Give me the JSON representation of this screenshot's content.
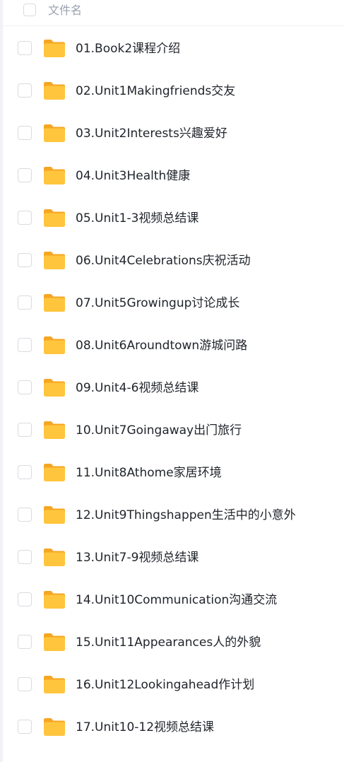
{
  "header": {
    "column_label": "文件名"
  },
  "folders": [
    {
      "name": "01.Book2课程介绍",
      "icon": "folder-icon"
    },
    {
      "name": "02.Unit1Makingfriends交友",
      "icon": "folder-icon"
    },
    {
      "name": "03.Unit2Interests兴趣爱好",
      "icon": "folder-icon"
    },
    {
      "name": "04.Unit3Health健康",
      "icon": "folder-icon"
    },
    {
      "name": "05.Unit1-3视频总结课",
      "icon": "folder-icon"
    },
    {
      "name": "06.Unit4Celebrations庆祝活动",
      "icon": "folder-icon"
    },
    {
      "name": "07.Unit5Growingup讨论成长",
      "icon": "folder-icon"
    },
    {
      "name": "08.Unit6Aroundtown游城问路",
      "icon": "folder-icon"
    },
    {
      "name": "09.Unit4-6视频总结课",
      "icon": "folder-icon"
    },
    {
      "name": "10.Unit7Goingaway出门旅行",
      "icon": "folder-icon"
    },
    {
      "name": "11.Unit8Athome家居环境",
      "icon": "folder-icon"
    },
    {
      "name": "12.Unit9Thingshappen生活中的小意外",
      "icon": "folder-icon"
    },
    {
      "name": "13.Unit7-9视频总结课",
      "icon": "folder-icon"
    },
    {
      "name": "14.Unit10Communication沟通交流",
      "icon": "folder-icon"
    },
    {
      "name": "15.Unit11Appearances人的外貌",
      "icon": "folder-icon"
    },
    {
      "name": "16.Unit12Lookingahead作计划",
      "icon": "folder-icon"
    },
    {
      "name": "17.Unit10-12视频总结课",
      "icon": "folder-icon"
    }
  ],
  "colors": {
    "folder_body": "#ffc53d",
    "folder_tab": "#f5a623",
    "text": "#1f2329",
    "header_text": "#9aa1ad",
    "checkbox_border": "#d8dbe0"
  }
}
